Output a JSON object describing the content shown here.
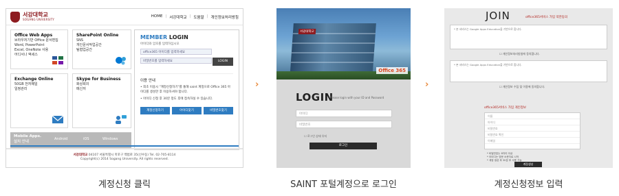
{
  "portal": {
    "logo_text": "서강대학교",
    "logo_sub": "SOGANG UNIVERSITY",
    "nav": [
      "HOME",
      "서강대학교",
      "도움말",
      "개인정보처리방침"
    ],
    "tiles": [
      {
        "title": "Office Web Apps",
        "lines": [
          "브라우저기반 Office 문서편집",
          "Word, PowerPoint",
          "Excel, OneNote 사용",
          "어디서나 액세스"
        ]
      },
      {
        "title": "SharePoint Online",
        "lines": [
          "SNS",
          "개인문서작업공간",
          "팀협업공간"
        ]
      },
      {
        "title": "Exchange Online",
        "lines": [
          "50GB 전자메일",
          "일정관리"
        ]
      },
      {
        "title": "Skype for Business",
        "lines": [
          "화상회의",
          "메신저"
        ]
      }
    ],
    "mobile": {
      "title": "Mobile Apps.",
      "sub": "설치 안내",
      "os": [
        "Android",
        "iOS",
        "Windows"
      ]
    },
    "login": {
      "title_a": "MEMBER",
      "title_b": "LOGIN",
      "sub": "아이디와 암호를 입력하십시오",
      "id_placeholder": "office365 아이디를 입력하세요",
      "pw_placeholder": "비밀번호를 입력하세요",
      "button": "LOGIN",
      "guide_title": "이용 안내",
      "guide_1": "• 최초 이용시 \"계정신청하기\"를 통해 saint 계정으로 Office 365 아이디를 생성한 후 이용하셔야 합니다.",
      "guide_2": "• 아이디 신청 후 30분 정도 후에 접속하실 수 있습니다.",
      "buttons": [
        "계정신청하기",
        "아이디찾기",
        "비밀번호찾기"
      ]
    },
    "footer_brand": "서강대학교",
    "footer_addr": "04107 서울특별시 마포구 백범로 35(신수동) Tel. 02-705-8114",
    "footer_copy": "Copyright(c) 2014 Sogang University. All rights reserved."
  },
  "saint": {
    "building_sign": "서강대학교",
    "office_badge": "Office 365",
    "title": "LOGIN",
    "sub": "Please login with your ID and Password",
    "id_placeholder": "아이디",
    "pw_placeholder": "비밀번호",
    "note": "☐ 로그인 상태 유지",
    "button": "로그인"
  },
  "join": {
    "title": "JOIN",
    "sub": "office365서비스 가입 약관동의",
    "terms_1": "* 본 서비스는 Google Apps Education을 기반으로 합니다.",
    "terms_check_1": "☐ 개인정보처리방침에 동의합니다.",
    "terms_2": "* 본 서비스는 Google Apps Education을 기반으로 합니다.",
    "terms_check_2": "☐ 개인정보 수집 및 이용에 동의합니다.",
    "form_head": "office365서비스 가입 개인정보",
    "form_rows": [
      "이름",
      "아이디",
      "비밀번호",
      "비밀번호 확인",
      "이메일"
    ],
    "notes": [
      "* 비밀번호는 8자리 이상",
      "* 아이디는 영문 소문자로 시작",
      "* 계정 생성 후 30분 후 사용 가능"
    ],
    "button": "계정생성"
  },
  "captions": [
    "계정신청 클릭",
    "SAINT 포털계정으로 로그인",
    "계정신청정보 입력"
  ],
  "arrow": "›"
}
